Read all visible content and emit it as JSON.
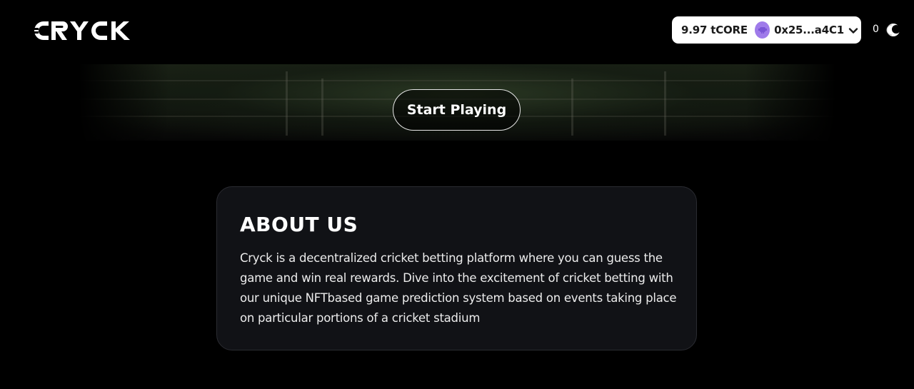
{
  "brand": {
    "name": "CRYCK",
    "logo_icon": "cryck-logo"
  },
  "header": {
    "balance": "9.97 tCORE",
    "account_address": "0x25...a4C1",
    "avatar_icon": "wallet-avatar-icon",
    "dropdown_icon": "chevron-down-icon",
    "coin_count": "0",
    "coin_icon": "cryck-coin-icon"
  },
  "hero": {
    "cta_label": "Start Playing"
  },
  "about": {
    "title": "ABOUT US",
    "text": "Cryck is a decentralized cricket betting platform where you can guess the game and win real rewards. Dive into the excitement of cricket betting with our unique NFTbased game prediction system based on events taking place on particular portions of a cricket stadium"
  },
  "colors": {
    "background": "#000000",
    "card_background": "#111216",
    "card_border": "#2a2b31",
    "wallet_pill": "#ffffff",
    "avatar": "#9f7bea"
  }
}
